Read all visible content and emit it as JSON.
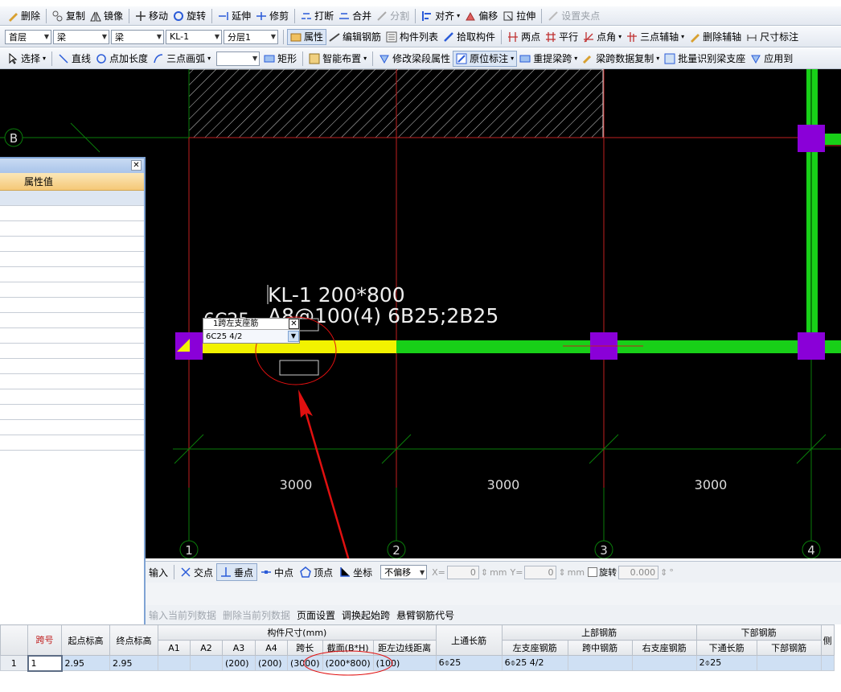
{
  "toolbar1": {
    "delete": "删除",
    "copy": "复制",
    "mirror": "镜像",
    "move": "移动",
    "rotate": "旋转",
    "extend": "延伸",
    "trim": "修剪",
    "break": "打断",
    "merge": "合并",
    "split": "分割",
    "align": "对齐",
    "offset": "偏移",
    "stretch": "拉伸",
    "set_grip": "设置夹点"
  },
  "toolbar2": {
    "floor": "首层",
    "category": "梁",
    "type": "梁",
    "component": "KL-1",
    "layer": "分层1",
    "property": "属性",
    "edit_rebar": "编辑钢筋",
    "component_list": "构件列表",
    "pick_component": "拾取构件",
    "two_points": "两点",
    "parallel": "平行",
    "point_angle": "点角",
    "three_point_axis": "三点辅轴",
    "delete_axis": "删除辅轴",
    "dim_label": "尺寸标注"
  },
  "toolbar3": {
    "select": "选择",
    "line": "直线",
    "point_length": "点加长度",
    "three_point_arc": "三点画弧",
    "rect": "矩形",
    "smart_layout": "智能布置",
    "modify_span": "修改梁段属性",
    "in_situ_label": "原位标注",
    "re_extract_span": "重提梁跨",
    "span_data_copy": "梁跨数据复制",
    "batch_identify": "批量识别梁支座",
    "apply_to": "应用到"
  },
  "canvas": {
    "axis_b": "B",
    "axes": [
      "1",
      "2",
      "3",
      "4"
    ],
    "dims": [
      "3000",
      "3000",
      "3000"
    ],
    "beam_label_1": "KL-1 200*800",
    "beam_label_2": "A8@100(4) 6B25;2B25",
    "beam_label_left": "6C25",
    "popup_title": "1跨左支座筋",
    "popup_value": "6C25 4/2"
  },
  "props": {
    "header": "属性值"
  },
  "snap": {
    "input": "输入",
    "intersection": "交点",
    "perpendicular": "垂点",
    "midpoint": "中点",
    "vertex": "顶点",
    "coordinate": "坐标",
    "offset_mode": "不偏移",
    "x_label": "X=",
    "x_value": "0",
    "y_label": "Y=",
    "y_value": "0",
    "unit": "mm",
    "rotate": "旋转",
    "rotate_value": "0.000",
    "deg": "°"
  },
  "gridtb": {
    "input_col": "输入当前列数据",
    "delete_col": "删除当前列数据",
    "page_setup": "页面设置",
    "swap_span": "调换起始跨",
    "cantilever_code": "悬臂钢筋代号"
  },
  "table": {
    "h_span": "跨号",
    "h_start_elev": "起点标高",
    "h_end_elev": "终点标高",
    "h_a1": "A1",
    "h_a2": "A2",
    "h_a3": "A3",
    "h_a4": "A4",
    "h_dims": "构件尺寸(mm)",
    "h_span_len": "跨长",
    "h_section": "截面(B*H)",
    "h_left_edge": "距左边线距离",
    "h_top_through": "上通长筋",
    "h_top_rebar": "上部钢筋",
    "h_left_support": "左支座钢筋",
    "h_mid_span": "跨中钢筋",
    "h_right_support": "右支座钢筋",
    "h_bottom_rebar": "下部钢筋",
    "h_bottom_through": "下通长筋",
    "h_bottom_part": "下部钢筋",
    "h_more": "侧",
    "row_num": "1",
    "row": {
      "span": "1",
      "start": "2.95",
      "end": "2.95",
      "a1": "",
      "a2": "",
      "a3": "(200)",
      "a4": "(200)",
      "len": "(3000)",
      "section": "(200*800)",
      "left_edge": "(100)",
      "top_through": "6⌽25",
      "left_support": "6⌽25 4/2",
      "mid": "",
      "right": "",
      "bottom_through": "2⌽25",
      "bottom": ""
    }
  }
}
